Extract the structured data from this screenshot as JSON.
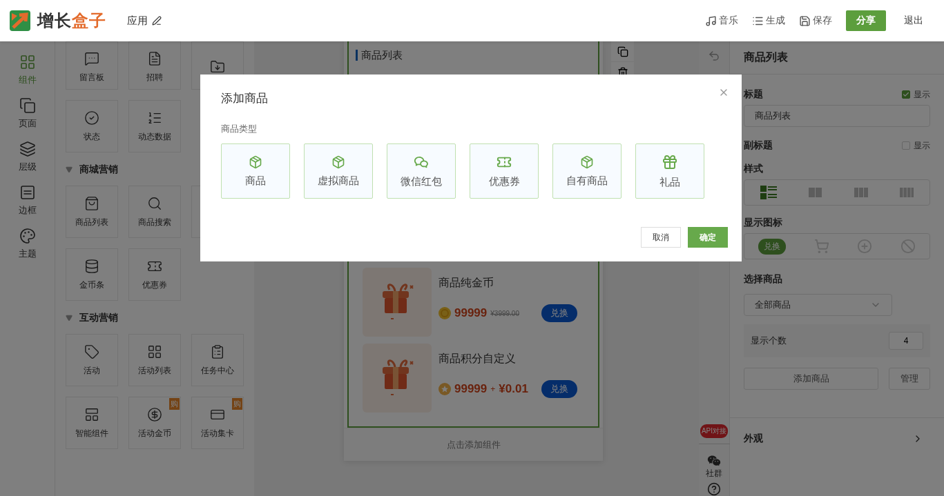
{
  "header": {
    "logo_a": "增长",
    "logo_b": "盒子",
    "app_name": "应用",
    "actions": [
      {
        "label": "音乐"
      },
      {
        "label": "生成"
      },
      {
        "label": "保存"
      }
    ],
    "share": "分享",
    "exit": "退出"
  },
  "nav": [
    {
      "label": "组件",
      "selected": true
    },
    {
      "label": "页面",
      "selected": false
    },
    {
      "label": "层级",
      "selected": false
    },
    {
      "label": "边框",
      "selected": false
    },
    {
      "label": "主题",
      "selected": false
    }
  ],
  "component_groups": [
    {
      "tiles": [
        {
          "kind": "tile",
          "label": "留言板"
        },
        {
          "kind": "tile",
          "label": "招聘"
        },
        {
          "kind": "covered"
        },
        {
          "kind": "tile",
          "label": "状态"
        },
        {
          "kind": "tile",
          "label": "动态数据"
        }
      ]
    },
    {
      "title": "商城营销",
      "tiles": [
        {
          "kind": "tile",
          "label": "商品列表"
        },
        {
          "kind": "tile",
          "label": "商品搜索"
        },
        {
          "kind": "covered"
        },
        {
          "kind": "tile",
          "label": "金币条"
        },
        {
          "kind": "tile",
          "label": "优惠券"
        }
      ]
    },
    {
      "title": "互动营销",
      "tiles": [
        {
          "kind": "tile",
          "label": "活动"
        },
        {
          "kind": "tile",
          "label": "活动列表"
        },
        {
          "kind": "tile",
          "label": "任务中心"
        },
        {
          "kind": "tile",
          "label": "智能组件"
        },
        {
          "kind": "tile",
          "label": "活动金币",
          "badge": "购"
        },
        {
          "kind": "tile",
          "label": "活动集卡",
          "badge": "购"
        }
      ]
    }
  ],
  "preview": {
    "title": "商品列表",
    "products": [
      {
        "name": "商品纯金币",
        "kind": "coin",
        "price": "99999",
        "original": "¥3999.00",
        "button": "兑换"
      },
      {
        "name": "商品积分自定义",
        "kind": "points",
        "price": "99999",
        "plus": "+",
        "cash": "¥0.01",
        "button": "兑换"
      }
    ],
    "add_component": "点击添加组件"
  },
  "side_tools": {
    "api": "API对接",
    "community": "社群"
  },
  "settings": {
    "title": "商品列表",
    "title_label": "标题",
    "title_show": {
      "label": "显示",
      "checked": true
    },
    "title_value": "商品列表",
    "subtitle_label": "副标题",
    "subtitle_show": {
      "label": "显示",
      "checked": false
    },
    "style_label": "样式",
    "styles": [
      {
        "selected": true
      },
      {
        "selected": false
      },
      {
        "selected": false
      },
      {
        "selected": false
      }
    ],
    "icon_label": "显示图标",
    "icons": [
      {
        "kind": "text",
        "label": "兑换",
        "selected": true
      },
      {
        "kind": "cart",
        "selected": false
      },
      {
        "kind": "plus",
        "selected": false
      },
      {
        "kind": "ban",
        "selected": false
      }
    ],
    "select_label": "选择商品",
    "select_value": "全部商品",
    "count_label": "显示个数",
    "count_value": "4",
    "add_button": "添加商品",
    "manage_button": "管理",
    "appearance": "外观"
  },
  "dialog": {
    "title": "添加商品",
    "type_label": "商品类型",
    "types": [
      {
        "label": "商品",
        "kind": "box"
      },
      {
        "label": "虚拟商品",
        "kind": "box"
      },
      {
        "label": "微信红包",
        "kind": "wechat"
      },
      {
        "label": "优惠券",
        "kind": "ticket"
      },
      {
        "label": "自有商品",
        "kind": "box"
      },
      {
        "label": "礼品",
        "kind": "gift"
      }
    ],
    "cancel": "取消",
    "confirm": "确定"
  }
}
